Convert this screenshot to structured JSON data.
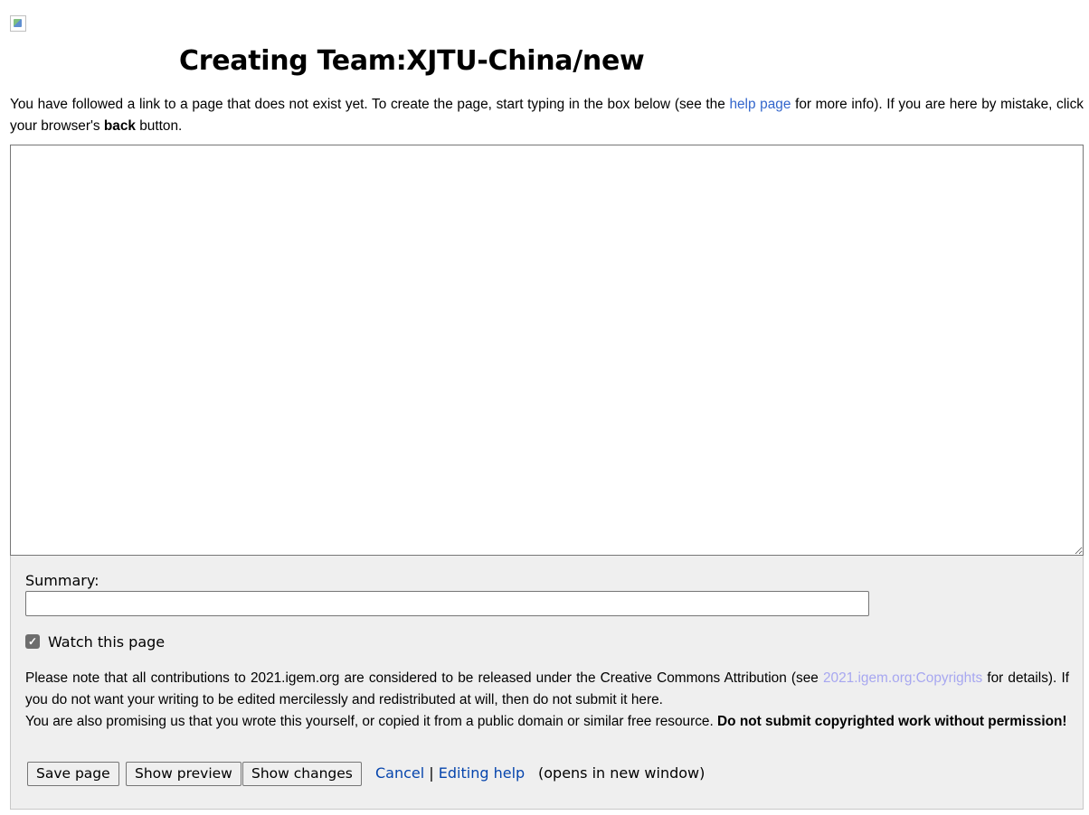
{
  "page": {
    "title": "Creating Team:XJTU-China/new"
  },
  "intro": {
    "text_1": "You have followed a link to a page that does not exist yet. To create the page, start typing in the box below (see the ",
    "help_link": "help page",
    "text_2": " for more info). If you are here by mistake, click your browser's ",
    "back_bold": "back",
    "text_3": " button."
  },
  "editor": {
    "content": ""
  },
  "summary": {
    "label": "Summary:",
    "value": ""
  },
  "watch": {
    "label": "Watch this page",
    "checked": true
  },
  "notice": {
    "text_1": "Please note that all contributions to 2021.igem.org are considered to be released under the Creative Commons Attribution (see ",
    "copyright_link": "2021.igem.org:Copyrights",
    "text_2": " for details). If you do not want your writing to be edited mercilessly and redistributed at will, then do not submit it here.",
    "text_3": "You are also promising us that you wrote this yourself, or copied it from a public domain or similar free resource. ",
    "bold_warning": "Do not submit copyrighted work without permission!"
  },
  "buttons": {
    "save": "Save page",
    "preview": "Show preview",
    "changes": "Show changes"
  },
  "links": {
    "cancel": "Cancel",
    "separator": "|",
    "editing_help": "Editing help",
    "note": "(opens in new window)"
  }
}
